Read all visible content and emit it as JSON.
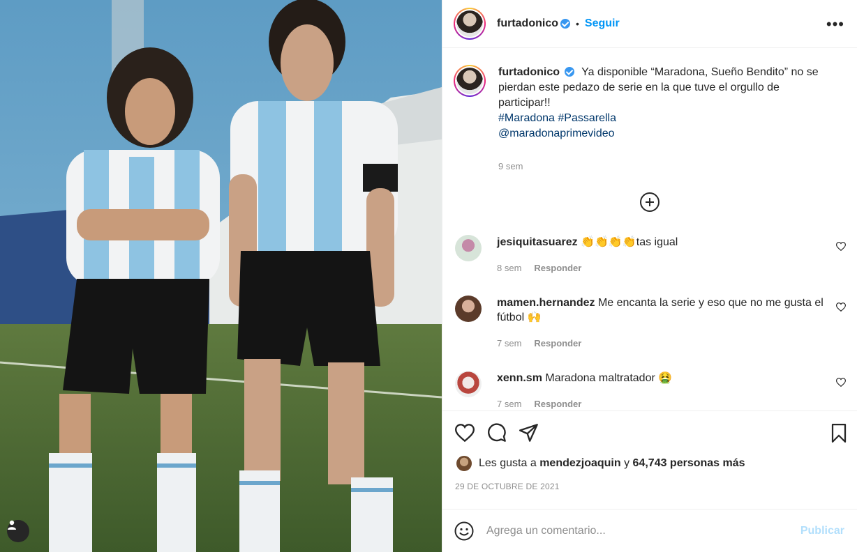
{
  "post": {
    "author": "furtadonico",
    "follow_label": "Seguir",
    "separator": "•",
    "more_label": "•••"
  },
  "caption": {
    "username": "furtadonico",
    "text": "Ya disponible “Maradona, Sueño Bendito” no se pierdan este pedazo de serie en la que tuve el orgullo de participar!!",
    "hashtags": "#Maradona #Passarella",
    "mention": "@maradonaprimevideo",
    "time": "9 sem"
  },
  "comments": [
    {
      "username": "jesiquitasuarez",
      "text": "👏👏👏👏tas igual",
      "time": "8 sem",
      "reply": "Responder"
    },
    {
      "username": "mamen.hernandez",
      "text": "Me encanta la serie y eso que no me gusta el fútbol 🙌",
      "time": "7 sem",
      "reply": "Responder"
    },
    {
      "username": "xenn.sm",
      "text": "Maradona maltratador 🤮",
      "time": "7 sem",
      "reply": "Responder"
    }
  ],
  "likes": {
    "prefix": "Les gusta a",
    "user": "mendezjoaquin",
    "conj": "y",
    "count_text": "64,743 personas más"
  },
  "date": "29 DE OCTUBRE DE 2021",
  "composer": {
    "placeholder": "Agrega un comentario...",
    "publish_label": "Publicar"
  },
  "colors": {
    "accent": "#0095f6",
    "link": "#00376b",
    "muted": "#8e8e8e",
    "publish_disabled": "#b2dffc"
  },
  "icons": [
    "user-tag-icon",
    "verified-icon",
    "more-options-icon",
    "load-more-icon",
    "heart-icon",
    "comment-icon",
    "share-icon",
    "save-icon",
    "emoji-icon"
  ]
}
